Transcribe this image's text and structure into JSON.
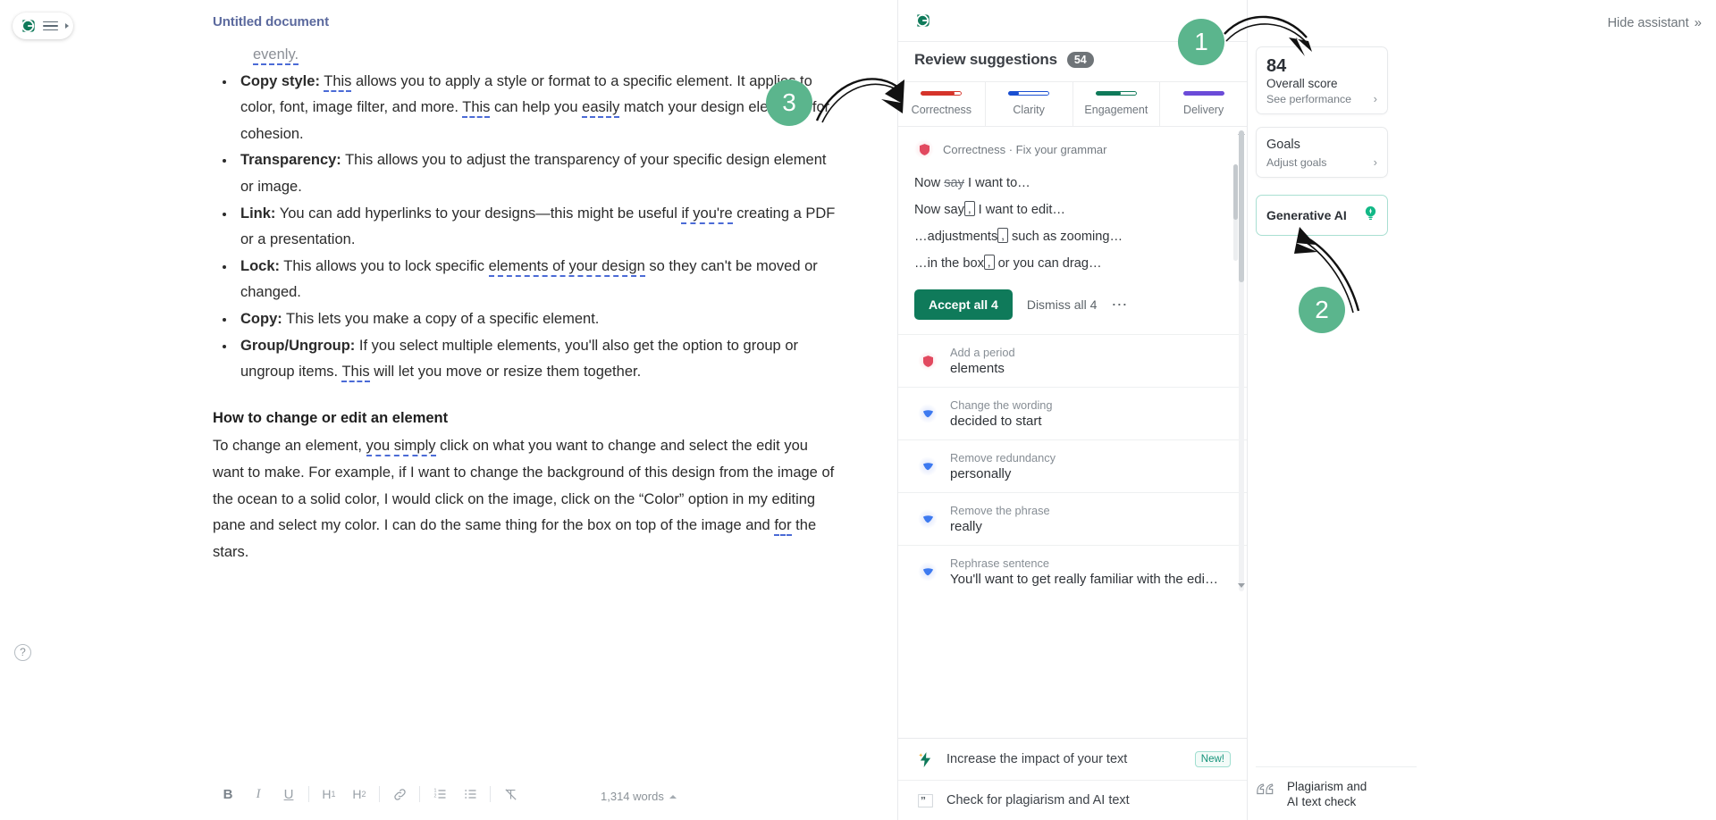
{
  "app": {
    "logo": "grammarly-logo",
    "menu_icon": "hamburger-menu-icon",
    "help_icon": "?"
  },
  "document": {
    "title": "Untitled document",
    "word_count": "1,314 words",
    "clipped_top": "evenly.",
    "bullets": [
      {
        "term": "Copy style:",
        "text_parts": [
          {
            "t": " ",
            "style": "plain"
          },
          {
            "t": "This",
            "style": "suggestion"
          },
          {
            "t": " allows you to apply a style or format to a specific element. It applies to color, font, image filter, and more. ",
            "style": "plain"
          },
          {
            "t": "This",
            "style": "suggestion"
          },
          {
            "t": " can help you ",
            "style": "plain"
          },
          {
            "t": "easily",
            "style": "suggestion"
          },
          {
            "t": " match your design elements for cohesion.",
            "style": "plain"
          }
        ]
      },
      {
        "term": "Transparency:",
        "text_parts": [
          {
            "t": " This allows you to adjust the transparency of your specific design element or image.",
            "style": "plain"
          }
        ]
      },
      {
        "term": "Link:",
        "text_parts": [
          {
            "t": " You can add hyperlinks to your designs—this might be useful ",
            "style": "plain"
          },
          {
            "t": "if you're",
            "style": "suggestion"
          },
          {
            "t": " creating a PDF or a presentation.",
            "style": "plain"
          }
        ]
      },
      {
        "term": "Lock:",
        "text_parts": [
          {
            "t": " This allows you to lock specific ",
            "style": "plain"
          },
          {
            "t": "elements of your design",
            "style": "suggestion"
          },
          {
            "t": " so they can't be moved or changed.",
            "style": "plain"
          }
        ]
      },
      {
        "term": "Copy:",
        "text_parts": [
          {
            "t": " This lets you make a copy of a specific element.",
            "style": "plain"
          }
        ]
      },
      {
        "term": "Group/Ungroup:",
        "text_parts": [
          {
            "t": " If you select multiple elements, you'll also get the option to group or ungroup items. ",
            "style": "plain"
          },
          {
            "t": "This",
            "style": "suggestion"
          },
          {
            "t": " will let you move or resize them together.",
            "style": "plain"
          }
        ]
      }
    ],
    "heading": "How to change or edit an element",
    "paragraph_parts": [
      {
        "t": "To change an element, ",
        "style": "plain"
      },
      {
        "t": "you simply",
        "style": "suggestion"
      },
      {
        "t": " click on what you want to change and select the edit you want to make. For example, if I want to change the background of this design from the image of the ocean to a solid color, I would click on the image, click on the “Color” option in my editing pane and select my color. I can do the same thing for the box on top of the image and ",
        "style": "plain"
      },
      {
        "t": "for",
        "style": "suggestion"
      },
      {
        "t": " the stars.",
        "style": "plain"
      }
    ]
  },
  "toolbar": {
    "buttons": [
      {
        "label": "B",
        "name": "bold-button"
      },
      {
        "label": "I",
        "name": "italic-button"
      },
      {
        "label": "U",
        "name": "underline-button"
      },
      {
        "label": "H1",
        "name": "heading1-button"
      },
      {
        "label": "H2",
        "name": "heading2-button"
      },
      {
        "label": "link",
        "name": "link-button"
      },
      {
        "label": "ol",
        "name": "numbered-list-button"
      },
      {
        "label": "ul",
        "name": "bullet-list-button"
      },
      {
        "label": "clear",
        "name": "clear-formatting-button"
      }
    ]
  },
  "assistant": {
    "title": "Review suggestions",
    "count": "54",
    "categories": [
      {
        "label": "Correctness",
        "color": "#d5342a",
        "fill_pct": 82
      },
      {
        "label": "Clarity",
        "color": "#1a4fd1",
        "fill_pct": 25
      },
      {
        "label": "Engagement",
        "color": "#0f7a5a",
        "fill_pct": 62
      },
      {
        "label": "Delivery",
        "color": "#6b4bd8",
        "fill_pct": 100
      }
    ],
    "active_card": {
      "header": "Correctness · Fix your grammar",
      "header_icon": "shield-icon",
      "lines": [
        {
          "prefix": "Now ",
          "strike": "say",
          "suffix": " I want to…",
          "type": "delete"
        },
        {
          "prefix": "Now say",
          "insert": ",",
          "suffix": " I want to edit…",
          "type": "insert"
        },
        {
          "prefix": "…adjustments",
          "insert": ",",
          "suffix": " such as zooming…",
          "type": "insert"
        },
        {
          "prefix": "…in the box",
          "insert": ",",
          "suffix": " or you can drag…",
          "type": "insert"
        }
      ],
      "accept_label": "Accept all 4",
      "dismiss_label": "Dismiss all 4",
      "more_label": "…"
    },
    "suggestions": [
      {
        "kind": "Add a period",
        "text": "elements",
        "icon": "shield-icon",
        "tone": "red"
      },
      {
        "kind": "Change the wording",
        "text": "decided to start",
        "icon": "clarity-icon",
        "tone": "blue"
      },
      {
        "kind": "Remove redundancy",
        "text": "personally",
        "icon": "clarity-icon",
        "tone": "blue"
      },
      {
        "kind": "Remove the phrase",
        "text": "really",
        "icon": "clarity-icon",
        "tone": "blue"
      },
      {
        "kind": "Rephrase sentence",
        "text": "You'll want to get really familiar with the editing…",
        "icon": "clarity-icon",
        "tone": "blue"
      }
    ],
    "footer": [
      {
        "label": "Increase the impact of your text",
        "icon": "lightning-icon",
        "badge": "New!"
      },
      {
        "label": "Check for plagiarism and AI text",
        "icon": "quote-icon",
        "badge": ""
      }
    ]
  },
  "rail": {
    "hide_assistant": "Hide assistant",
    "hide_assistant_icon": "double-chevron-right-icon",
    "score": {
      "value": "84",
      "caption": "Overall score",
      "sub": "See performance"
    },
    "goals": {
      "caption": "Goals",
      "sub": "Adjust goals"
    },
    "generative_ai": {
      "label": "Generative AI",
      "icon": "lightbulb-icon"
    },
    "plagiarism": {
      "label": "Plagiarism and\nAI text check",
      "line1": "Plagiarism and",
      "line2": "AI text check",
      "icon": "quote-icon"
    }
  },
  "annotations": [
    {
      "number": "1",
      "target": "score-card"
    },
    {
      "number": "2",
      "target": "generative-ai-card"
    },
    {
      "number": "3",
      "target": "correctness-tab"
    }
  ],
  "colors": {
    "brand_green": "#0f7a5a",
    "marker_green": "#5bb58d",
    "correctness_red": "#d5342a",
    "clarity_blue": "#1a4fd1",
    "engagement_green": "#0f7a5a",
    "delivery_purple": "#6b4bd8",
    "doc_title_blue": "#5c6a9e"
  }
}
